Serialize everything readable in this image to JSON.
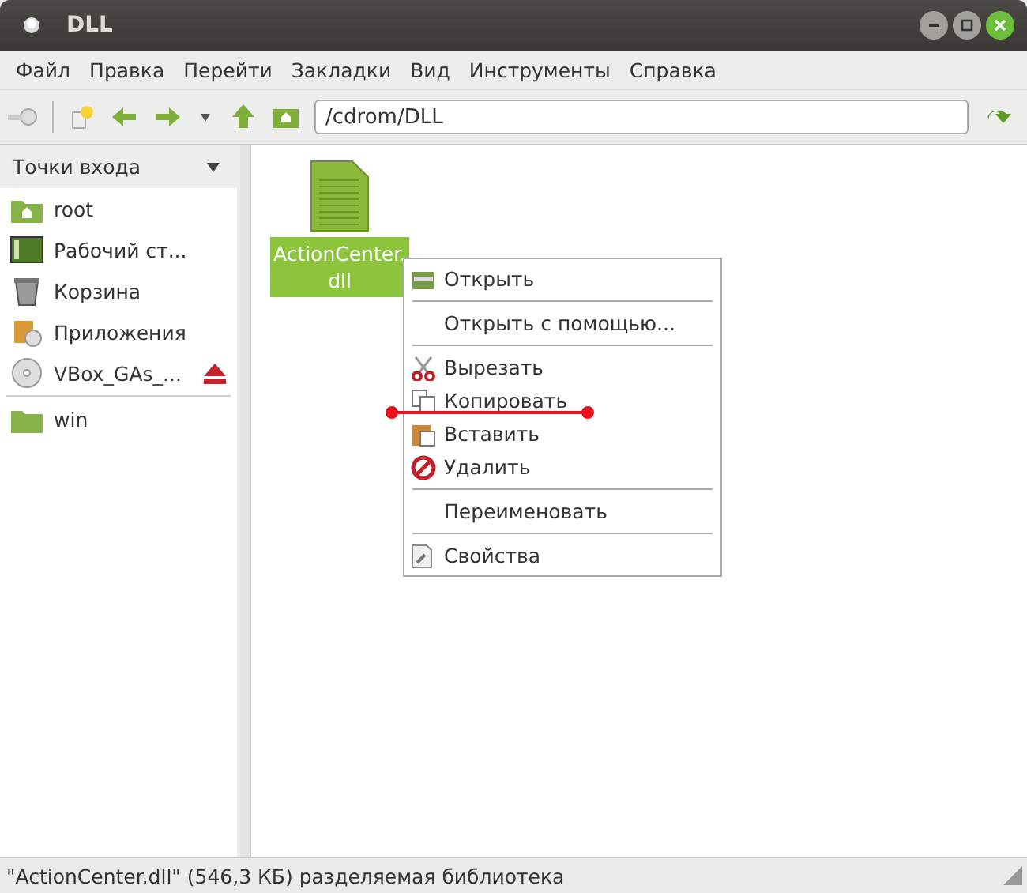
{
  "window": {
    "title": "DLL"
  },
  "menu": [
    "Файл",
    "Правка",
    "Перейти",
    "Закладки",
    "Вид",
    "Инструменты",
    "Справка"
  ],
  "location": {
    "value": "/cdrom/DLL"
  },
  "sidebar": {
    "title": "Точки входа",
    "items": [
      {
        "label": "root",
        "ejectable": false,
        "kind": "place"
      },
      {
        "label": "Рабочий ст...",
        "ejectable": false,
        "kind": "place"
      },
      {
        "label": "Корзина",
        "ejectable": false,
        "kind": "place"
      },
      {
        "label": "Приложения",
        "ejectable": false,
        "kind": "place"
      },
      {
        "label": "VBox_GAs_...",
        "ejectable": true,
        "kind": "place"
      },
      {
        "kind": "separator"
      },
      {
        "label": "win",
        "ejectable": false,
        "kind": "place"
      }
    ]
  },
  "files": [
    {
      "name": "ActionCenter.\ndll",
      "selected": true
    }
  ],
  "context_menu": [
    {
      "kind": "item",
      "label": "Открыть"
    },
    {
      "kind": "separator"
    },
    {
      "kind": "item",
      "label": "Открыть с помощью..."
    },
    {
      "kind": "separator"
    },
    {
      "kind": "item",
      "label": "Вырезать"
    },
    {
      "kind": "item",
      "label": "Копировать",
      "underlined": true
    },
    {
      "kind": "item",
      "label": "Вставить"
    },
    {
      "kind": "item",
      "label": "Удалить"
    },
    {
      "kind": "separator"
    },
    {
      "kind": "item",
      "label": "Переименовать"
    },
    {
      "kind": "separator"
    },
    {
      "kind": "item",
      "label": "Свойства"
    }
  ],
  "status_bar": "\"ActionCenter.dll\" (546,3 КБ) разделяемая библиотека"
}
